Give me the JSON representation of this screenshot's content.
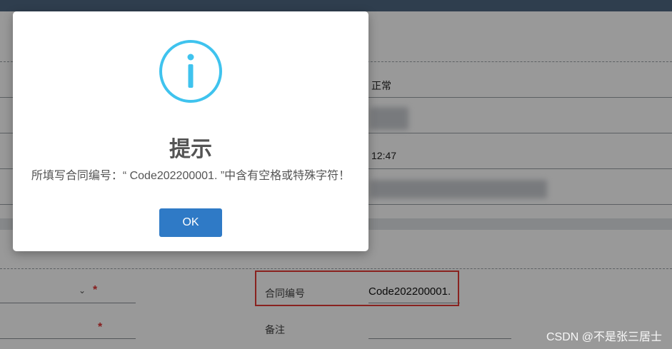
{
  "table": {
    "status_value": "正常",
    "time_value": "12:47"
  },
  "form": {
    "contract_label": "合同编号",
    "contract_value": "Code202200001.",
    "remark_label": "备注",
    "required_mark": "*",
    "dropdown_chevron": "⌄"
  },
  "dialog": {
    "icon": "info-icon",
    "title": "提示",
    "message": "所填写合同编号：“ Code202200001. ”中含有空格或特殊字符！",
    "ok_label": "OK"
  },
  "watermark": "CSDN @不是张三居士",
  "colors": {
    "info_icon": "#3fc3ee",
    "ok_button": "#2f7ac6",
    "highlight_box": "#e53935",
    "required": "#e03131"
  }
}
